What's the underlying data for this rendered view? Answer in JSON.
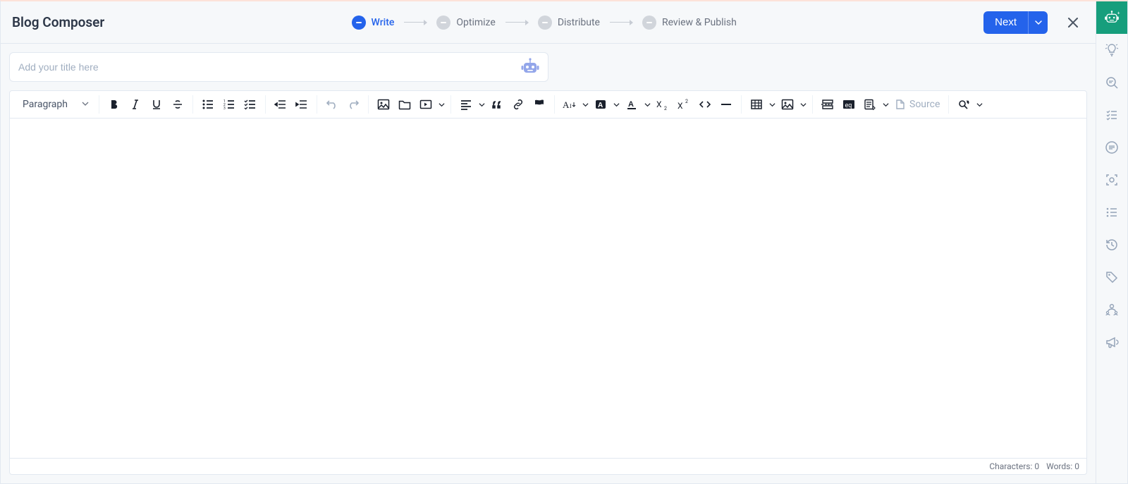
{
  "header": {
    "title": "Blog Composer",
    "next_label": "Next"
  },
  "steps": [
    {
      "name": "write",
      "label": "Write",
      "active": true
    },
    {
      "name": "optimize",
      "label": "Optimize",
      "active": false
    },
    {
      "name": "distribute",
      "label": "Distribute",
      "active": false
    },
    {
      "name": "review",
      "label": "Review & Publish",
      "active": false
    }
  ],
  "title_input": {
    "placeholder": "Add your title here",
    "value": ""
  },
  "toolbar": {
    "paragraph_label": "Paragraph",
    "source_label": "Source"
  },
  "status": {
    "characters_label": "Characters:",
    "characters_value": 0,
    "words_label": "Words:",
    "words_value": 0
  },
  "rail": {
    "items": [
      "ai-assist",
      "ideas",
      "seo",
      "outline",
      "notes",
      "focus",
      "revisions",
      "history",
      "tags",
      "collab",
      "promote"
    ],
    "active_index": 0
  }
}
